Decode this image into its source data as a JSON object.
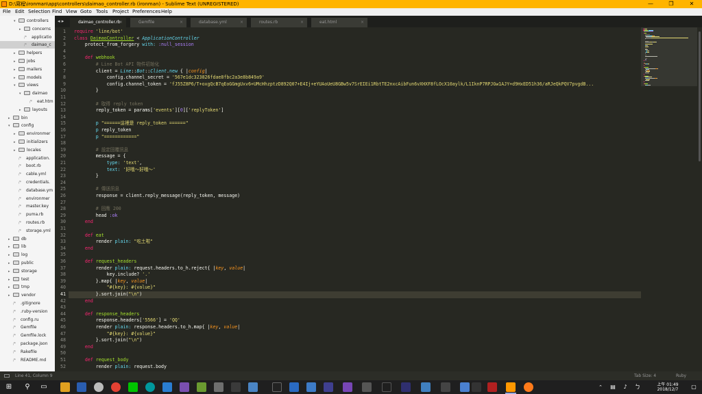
{
  "window": {
    "title": "D:\\寫程\\ironman\\app\\controllers\\daimao_controller.rb (ironman) - Sublime Text (UNREGISTERED)",
    "minimize": "—",
    "maximize": "❐",
    "close": "✕"
  },
  "menu": [
    "File",
    "Edit",
    "Selection",
    "Find",
    "View",
    "Goto",
    "Tools",
    "Project",
    "Preferences",
    "Help"
  ],
  "sidebar": {
    "items": [
      {
        "label": "controllers",
        "kind": "folder",
        "open": true,
        "depth": 2
      },
      {
        "label": "concerns",
        "kind": "folder",
        "open": false,
        "depth": 3
      },
      {
        "label": "applicatio",
        "kind": "file",
        "depth": 3
      },
      {
        "label": "daimao_c",
        "kind": "file",
        "depth": 3,
        "selected": true
      },
      {
        "label": "helpers",
        "kind": "folder",
        "open": false,
        "depth": 2
      },
      {
        "label": "jobs",
        "kind": "folder",
        "open": false,
        "depth": 2
      },
      {
        "label": "mailers",
        "kind": "folder",
        "open": false,
        "depth": 2
      },
      {
        "label": "models",
        "kind": "folder",
        "open": false,
        "depth": 2
      },
      {
        "label": "views",
        "kind": "folder",
        "open": true,
        "depth": 2
      },
      {
        "label": "daimao",
        "kind": "folder",
        "open": true,
        "depth": 3
      },
      {
        "label": "eat.htm",
        "kind": "file",
        "depth": 4
      },
      {
        "label": "layouts",
        "kind": "folder",
        "open": false,
        "depth": 3
      },
      {
        "label": "bin",
        "kind": "folder",
        "open": false,
        "depth": 1
      },
      {
        "label": "config",
        "kind": "folder",
        "open": true,
        "depth": 1
      },
      {
        "label": "environmer",
        "kind": "folder",
        "open": false,
        "depth": 2
      },
      {
        "label": "initializers",
        "kind": "folder",
        "open": false,
        "depth": 2
      },
      {
        "label": "locales",
        "kind": "folder",
        "open": false,
        "depth": 2
      },
      {
        "label": "application.",
        "kind": "file",
        "depth": 2
      },
      {
        "label": "boot.rb",
        "kind": "file",
        "depth": 2
      },
      {
        "label": "cable.yml",
        "kind": "file",
        "depth": 2
      },
      {
        "label": "credentials.",
        "kind": "file",
        "depth": 2
      },
      {
        "label": "database.ym",
        "kind": "file",
        "depth": 2
      },
      {
        "label": "environmer",
        "kind": "file",
        "depth": 2
      },
      {
        "label": "master.key",
        "kind": "file",
        "depth": 2
      },
      {
        "label": "puma.rb",
        "kind": "file",
        "depth": 2
      },
      {
        "label": "routes.rb",
        "kind": "file",
        "depth": 2
      },
      {
        "label": "storage.yml",
        "kind": "file",
        "depth": 2
      },
      {
        "label": "db",
        "kind": "folder",
        "open": false,
        "depth": 1
      },
      {
        "label": "lib",
        "kind": "folder",
        "open": false,
        "depth": 1
      },
      {
        "label": "log",
        "kind": "folder",
        "open": false,
        "depth": 1
      },
      {
        "label": "public",
        "kind": "folder",
        "open": false,
        "depth": 1
      },
      {
        "label": "storage",
        "kind": "folder",
        "open": false,
        "depth": 1
      },
      {
        "label": "test",
        "kind": "folder",
        "open": false,
        "depth": 1
      },
      {
        "label": "tmp",
        "kind": "folder",
        "open": false,
        "depth": 1
      },
      {
        "label": "vendor",
        "kind": "folder",
        "open": false,
        "depth": 1
      },
      {
        "label": ".gitignore",
        "kind": "file",
        "depth": 1
      },
      {
        "label": ".ruby-version",
        "kind": "file",
        "depth": 1
      },
      {
        "label": "config.ru",
        "kind": "file",
        "depth": 1
      },
      {
        "label": "Gemfile",
        "kind": "file",
        "depth": 1
      },
      {
        "label": "Gemfile.lock",
        "kind": "file",
        "depth": 1
      },
      {
        "label": "package.json",
        "kind": "file",
        "depth": 1
      },
      {
        "label": "Rakefile",
        "kind": "file",
        "depth": 1
      },
      {
        "label": "README.md",
        "kind": "file",
        "depth": 1
      }
    ]
  },
  "tabs": [
    {
      "label": "daimao_controller.rb",
      "active": true
    },
    {
      "label": "Gemfile",
      "active": false
    },
    {
      "label": "database.yml",
      "active": false
    },
    {
      "label": "routes.rb",
      "active": false
    },
    {
      "label": "eat.html",
      "active": false
    }
  ],
  "tab_close": "×",
  "nav_arrows": "◂ ▸",
  "editor": {
    "current_line": 41,
    "lines": [
      [
        [
          "k",
          "require "
        ],
        [
          "s",
          "'line/bot'"
        ]
      ],
      [
        [
          "k",
          "class "
        ],
        [
          "cls",
          "DaimaoController"
        ],
        [
          "t",
          " < "
        ],
        [
          "i",
          "ApplicationController"
        ]
      ],
      [
        [
          "t",
          "    protect_from_forgery "
        ],
        [
          "b",
          "with: "
        ],
        [
          "n",
          ":null_session"
        ]
      ],
      [],
      [
        [
          "t",
          "    "
        ],
        [
          "k",
          "def "
        ],
        [
          "d",
          "webhook"
        ]
      ],
      [
        [
          "c",
          "        # Line Bot API 物件初始化"
        ]
      ],
      [
        [
          "t",
          "        client = "
        ],
        [
          "i",
          "Line"
        ],
        [
          "t",
          "::"
        ],
        [
          "i",
          "Bot"
        ],
        [
          "t",
          "::"
        ],
        [
          "i",
          "Client"
        ],
        [
          "t",
          "."
        ],
        [
          "b",
          "new"
        ],
        [
          "t",
          " { |"
        ],
        [
          "o",
          "config"
        ],
        [
          "t",
          "|"
        ]
      ],
      [
        [
          "t",
          "            config.channel_secret = "
        ],
        [
          "s",
          "'567e1dc323826fdae8fbc2a3e8b849a9'"
        ]
      ],
      [
        [
          "t",
          "            config.channel_token = "
        ],
        [
          "s",
          "'fJ55Z8P6/T+oxgQcB7qEoGGmgUxv6+UMcHhzptzD892Q07+E4Ij+eYUAoUeU8GBw5v7SrEIEi1RbtTE2nxcAibFun6vXHXF8fLOcX10aylk/L1IknP7RPJGw1AJY+d9HxED51h36/aRJeQkPQV7pvgdB..."
        ]
      ],
      [
        [
          "t",
          "        }"
        ]
      ],
      [],
      [
        [
          "c",
          "        # 取得 reply token"
        ]
      ],
      [
        [
          "t",
          "        reply_token = params["
        ],
        [
          "s",
          "'events'"
        ],
        [
          "t",
          "]["
        ],
        [
          "n",
          "0"
        ],
        [
          "t",
          "]["
        ],
        [
          "s",
          "'replyToken'"
        ],
        [
          "t",
          "]"
        ]
      ],
      [],
      [
        [
          "t",
          "        "
        ],
        [
          "b",
          "p "
        ],
        [
          "s",
          "\"======這裡是 reply_token ======\""
        ]
      ],
      [
        [
          "t",
          "        "
        ],
        [
          "b",
          "p"
        ],
        [
          "t",
          " reply_token"
        ]
      ],
      [
        [
          "t",
          "        "
        ],
        [
          "b",
          "p "
        ],
        [
          "s",
          "\"============\""
        ]
      ],
      [],
      [
        [
          "c",
          "        # 設定回覆訊息"
        ]
      ],
      [
        [
          "t",
          "        message = {"
        ]
      ],
      [
        [
          "t",
          "            "
        ],
        [
          "b",
          "type: "
        ],
        [
          "s",
          "'text'"
        ],
        [
          "t",
          ","
        ]
      ],
      [
        [
          "t",
          "            "
        ],
        [
          "b",
          "text: "
        ],
        [
          "s",
          "'好哦～好哦～'"
        ]
      ],
      [
        [
          "t",
          "        }"
        ]
      ],
      [],
      [
        [
          "c",
          "        # 傳送訊息"
        ]
      ],
      [
        [
          "t",
          "        response = client.reply_message(reply_token, message)"
        ]
      ],
      [],
      [
        [
          "c",
          "        # 回應 200"
        ]
      ],
      [
        [
          "t",
          "        head "
        ],
        [
          "n",
          ":ok"
        ]
      ],
      [
        [
          "t",
          "    "
        ],
        [
          "k",
          "end"
        ]
      ],
      [],
      [
        [
          "t",
          "    "
        ],
        [
          "k",
          "def "
        ],
        [
          "d",
          "eat"
        ]
      ],
      [
        [
          "t",
          "        render "
        ],
        [
          "b",
          "plain: "
        ],
        [
          "s",
          "\"吃土啦\""
        ]
      ],
      [
        [
          "t",
          "    "
        ],
        [
          "k",
          "end"
        ]
      ],
      [],
      [
        [
          "t",
          "    "
        ],
        [
          "k",
          "def "
        ],
        [
          "d",
          "request_headers"
        ]
      ],
      [
        [
          "t",
          "        render "
        ],
        [
          "b",
          "plain: "
        ],
        [
          "t",
          "request.headers.to_h.reject{ |"
        ],
        [
          "o",
          "key"
        ],
        [
          "t",
          ", "
        ],
        [
          "o",
          "value"
        ],
        [
          "t",
          "|"
        ]
      ],
      [
        [
          "t",
          "            key.include? "
        ],
        [
          "s",
          "'.'"
        ]
      ],
      [
        [
          "t",
          "        }.map{ |"
        ],
        [
          "o",
          "key"
        ],
        [
          "t",
          ", "
        ],
        [
          "o",
          "value"
        ],
        [
          "t",
          "|"
        ]
      ],
      [
        [
          "t",
          "            "
        ],
        [
          "s",
          "\"#{key}: #{value}\""
        ]
      ],
      [
        [
          "t",
          "        }.sort.join("
        ],
        [
          "s",
          "\"\\n\""
        ],
        [
          "t",
          ")"
        ]
      ],
      [
        [
          "t",
          "    "
        ],
        [
          "k",
          "end"
        ]
      ],
      [],
      [
        [
          "t",
          "    "
        ],
        [
          "k",
          "def "
        ],
        [
          "d",
          "response_headers"
        ]
      ],
      [
        [
          "t",
          "        response.headers["
        ],
        [
          "s",
          "'5566'"
        ],
        [
          "t",
          "] = "
        ],
        [
          "s",
          "'QQ'"
        ]
      ],
      [
        [
          "t",
          "        render "
        ],
        [
          "b",
          "plain: "
        ],
        [
          "t",
          "response.headers.to_h.map{ |"
        ],
        [
          "o",
          "key"
        ],
        [
          "t",
          ", "
        ],
        [
          "o",
          "value"
        ],
        [
          "t",
          "|"
        ]
      ],
      [
        [
          "t",
          "            "
        ],
        [
          "s",
          "\"#{key}: #{value}\""
        ]
      ],
      [
        [
          "t",
          "        }.sort.join("
        ],
        [
          "s",
          "\"\\n\""
        ],
        [
          "t",
          ")"
        ]
      ],
      [
        [
          "t",
          "    "
        ],
        [
          "k",
          "end"
        ]
      ],
      [],
      [
        [
          "t",
          "    "
        ],
        [
          "k",
          "def "
        ],
        [
          "d",
          "request_body"
        ]
      ],
      [
        [
          "t",
          "        render "
        ],
        [
          "b",
          "plain: "
        ],
        [
          "t",
          "request.body"
        ]
      ]
    ]
  },
  "status": {
    "position": "Line 41, Column 9",
    "tab_size": "Tab Size: 4",
    "syntax": "Ruby"
  },
  "taskbar": {
    "time": "上午 01:49",
    "date": "2018/12/7"
  },
  "colors": {
    "title_bar": "#ffb400",
    "editor_bg": "#272822",
    "keyword": "#f92672",
    "string": "#e6db74",
    "comment": "#75715e",
    "function": "#a6e22e"
  }
}
